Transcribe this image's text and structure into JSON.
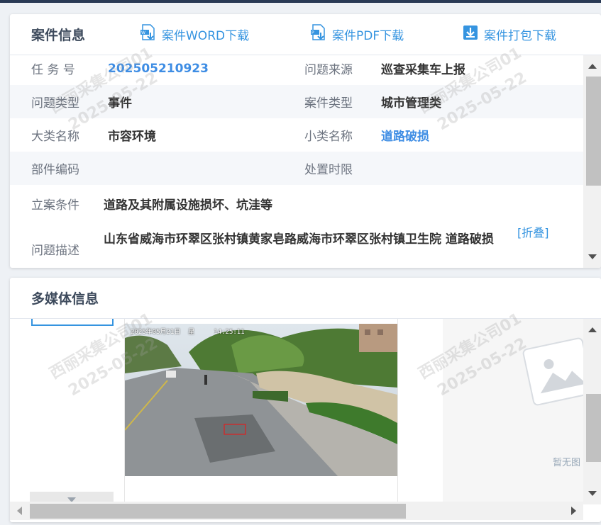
{
  "case_panel": {
    "title": "案件信息",
    "downloads": {
      "word": "案件WORD下载",
      "pdf": "案件PDF下载",
      "pack": "案件打包下载"
    },
    "fields": {
      "task_no_label": "任 务 号",
      "task_no_value": "202505210923",
      "source_label": "问题来源",
      "source_value": "巡查采集车上报",
      "problem_type_label": "问题类型",
      "problem_type_value": "事件",
      "case_type_label": "案件类型",
      "case_type_value": "城市管理类",
      "major_label": "大类名称",
      "major_value": "市容环境",
      "minor_label": "小类名称",
      "minor_value": "道路破损",
      "part_code_label": "部件编码",
      "part_code_value": "",
      "deadline_label": "处置时限",
      "deadline_value": "",
      "condition_label": "立案条件",
      "condition_value": "道路及其附属设施损坏、坑洼等",
      "description_label": "问题描述",
      "description_value": "山东省威海市环翠区张村镇黄家皂路威海市环翠区张村镇卫生院 道路破损",
      "collapse_label": "[折叠]"
    }
  },
  "media_panel": {
    "title": "多媒体信息",
    "photo_timestamp": "2025年05月21日  星     14:25:11",
    "no_image_text": "暂无图"
  },
  "watermark": {
    "line1": "西丽采集公司01",
    "line2": "2025-05-22"
  },
  "colors": {
    "accent": "#3594e0",
    "link_value": "#3e8de4",
    "title": "#3d4a5c",
    "label": "#6d7480"
  }
}
